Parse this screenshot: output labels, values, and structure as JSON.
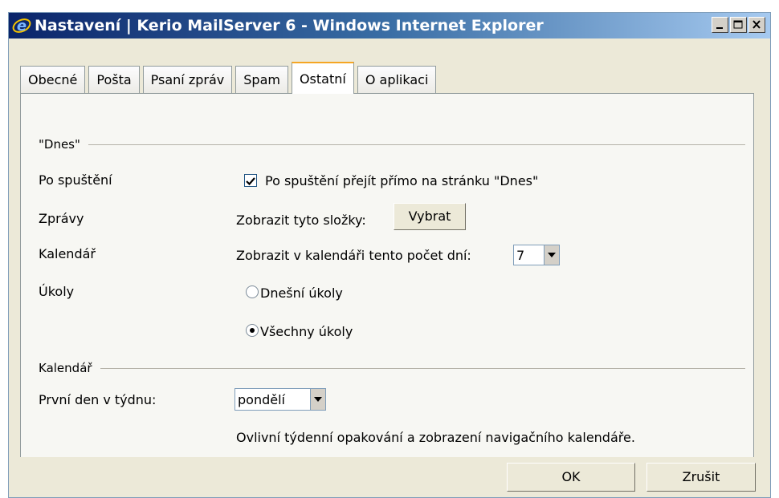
{
  "window": {
    "title": "Nastavení | Kerio MailServer 6 - Windows Internet Explorer"
  },
  "tabs": [
    {
      "label": "Obecné"
    },
    {
      "label": "Pošta"
    },
    {
      "label": "Psaní zpráv"
    },
    {
      "label": "Spam"
    },
    {
      "label": "Ostatní"
    },
    {
      "label": "O aplikaci"
    }
  ],
  "section_today": {
    "title": "\"Dnes\"",
    "startup_label": "Po spuštění",
    "startup_checkbox_label": "Po spuštění přejít přímo na stránku \"Dnes\"",
    "startup_checked": true,
    "messages_label": "Zprávy",
    "messages_text": "Zobrazit tyto složky:",
    "select_button": "Vybrat",
    "calendar_label": "Kalendář",
    "calendar_text": "Zobrazit v kalendáři tento počet dní:",
    "calendar_days": "7",
    "tasks_label": "Úkoly",
    "tasks_today": "Dnešní úkoly",
    "tasks_all": "Všechny úkoly",
    "tasks_selected": "Všechny úkoly"
  },
  "section_calendar": {
    "title": "Kalendář",
    "first_day_label": "První den v týdnu:",
    "first_day_value": "pondělí",
    "note": "Ovlivní týdenní opakování a zobrazení navigačního kalendáře."
  },
  "footer": {
    "ok": "OK",
    "cancel": "Zrušit"
  },
  "colors": {
    "titlebar": "#0a246a",
    "tab_active_accent": "#f5a623",
    "panel": "#f7f7f3"
  }
}
